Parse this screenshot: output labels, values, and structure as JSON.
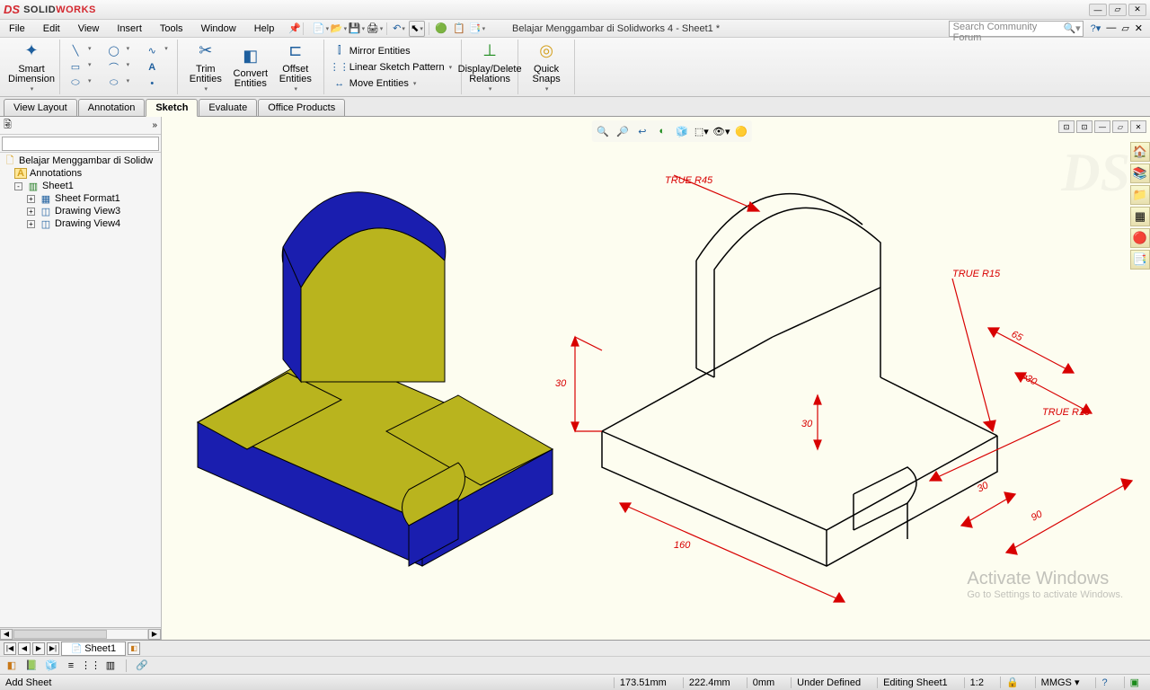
{
  "app": {
    "brand_symbol": "DS",
    "brand_name": "SOLID",
    "brand_name2": "WORKS"
  },
  "menu": [
    "File",
    "Edit",
    "View",
    "Insert",
    "Tools",
    "Window",
    "Help"
  ],
  "doc_title": "Belajar Menggambar di Solidworks 4 - Sheet1 *",
  "search": {
    "placeholder": "Search Community Forum"
  },
  "ribbon": {
    "smart_dim": "Smart\nDimension",
    "trim": "Trim\nEntities",
    "convert": "Convert\nEntities",
    "offset": "Offset\nEntities",
    "mirror": "Mirror Entities",
    "pattern": "Linear Sketch Pattern",
    "move": "Move Entities",
    "display": "Display/Delete\nRelations",
    "quick": "Quick\nSnaps"
  },
  "tabs": [
    "View Layout",
    "Annotation",
    "Sketch",
    "Evaluate",
    "Office Products"
  ],
  "active_tab": 2,
  "tree": {
    "root": "Belajar Menggambar di Solidw",
    "annotations": "Annotations",
    "sheet": "Sheet1",
    "sheet_format": "Sheet Format1",
    "view3": "Drawing View3",
    "view4": "Drawing View4"
  },
  "sheet_tab": "Sheet1",
  "dimensions": {
    "r45": "TRUE R45",
    "r15": "TRUE R15",
    "r10": "TRUE R10",
    "d30a": "30",
    "d30b": "30",
    "d160": "160",
    "d65": "65",
    "dia30": "⌀30",
    "d30c": "30",
    "d90": "90"
  },
  "watermark": {
    "line1": "Activate Windows",
    "line2": "Go to Settings to activate Windows."
  },
  "status": {
    "left": "Add Sheet",
    "x": "173.51mm",
    "y": "222.4mm",
    "z": "0mm",
    "constraint": "Under Defined",
    "mode": "Editing Sheet1",
    "scale": "1:2",
    "units": "MMGS"
  }
}
